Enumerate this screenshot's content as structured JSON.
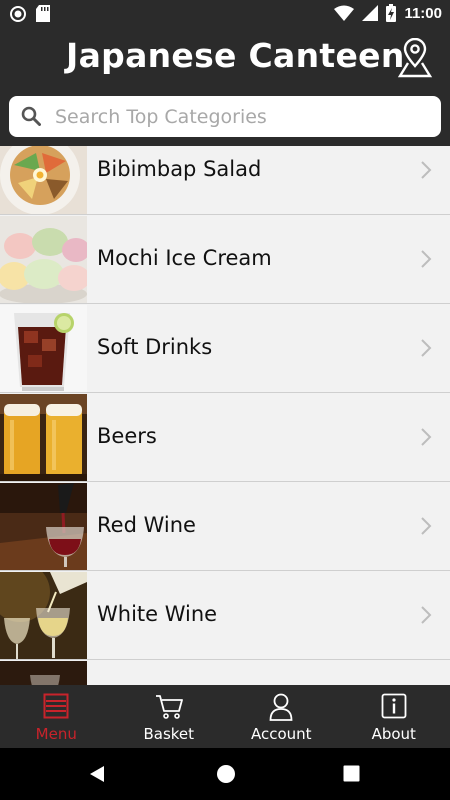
{
  "status_bar": {
    "time": "11:00"
  },
  "header": {
    "title": "Japanese Canteen"
  },
  "search": {
    "placeholder": "Search Top Categories"
  },
  "categories": [
    {
      "label": "Bibimbap Salad"
    },
    {
      "label": "Mochi Ice Cream"
    },
    {
      "label": "Soft Drinks"
    },
    {
      "label": "Beers"
    },
    {
      "label": "Red Wine"
    },
    {
      "label": "White Wine"
    },
    {
      "label": ""
    }
  ],
  "nav": {
    "active": "menu",
    "items": [
      {
        "label": "Menu",
        "icon": "menu-list-icon"
      },
      {
        "label": "Basket",
        "icon": "cart-icon"
      },
      {
        "label": "Account",
        "icon": "person-icon"
      },
      {
        "label": "About",
        "icon": "info-icon"
      }
    ]
  },
  "colors": {
    "accent": "#c8232b",
    "bar": "#2b2b2b",
    "list_bg": "#f2f2f2"
  }
}
